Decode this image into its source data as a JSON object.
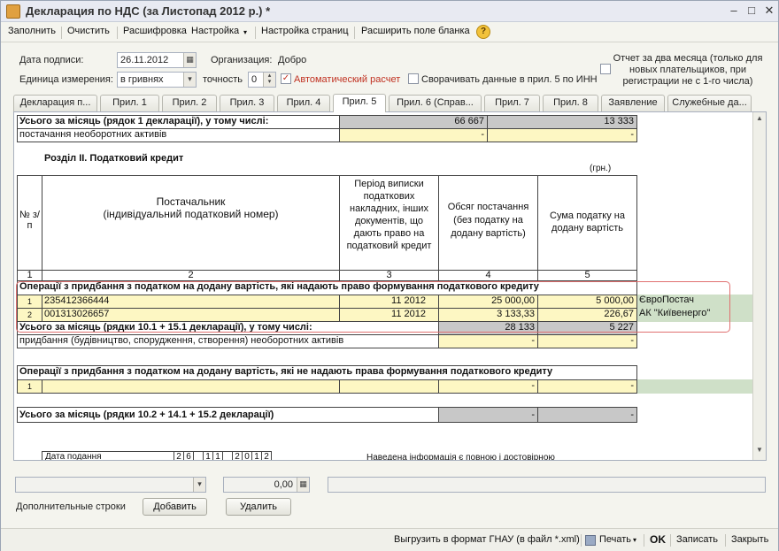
{
  "window": {
    "title": "Декларация по НДС (за Листопад 2012 р.) *",
    "minimize": "–",
    "maximize": "□",
    "close": "✕"
  },
  "toolbar": {
    "fill": "Заполнить",
    "clear": "Очистить",
    "decode": "Расшифровка",
    "settings": "Настройка",
    "settings_arrow": "▾",
    "page_settings": "Настройка страниц",
    "expand_form": "Расширить поле бланка",
    "help": "?"
  },
  "form": {
    "sign_date_label": "Дата подписи:",
    "sign_date": "26.11.2012",
    "org_label": "Организация:",
    "org_value": "Добро",
    "unit_label": "Единица измерения:",
    "unit_value": "в гривнях",
    "precision_label": "точность",
    "precision_value": "0",
    "auto_calc_label": "Автоматический расчет",
    "auto_calc_checked": "✓",
    "collapse_label": "Сворачивать данные в прил. 5 по ИНН",
    "two_month_report": "Отчет за два месяца (только для новых плательщиков, при регистрации не с 1-го числа)"
  },
  "tabs": [
    {
      "label": "Декларация п..."
    },
    {
      "label": "Прил. 1"
    },
    {
      "label": "Прил. 2"
    },
    {
      "label": "Прил. 3"
    },
    {
      "label": "Прил. 4"
    },
    {
      "label": "Прил. 5"
    },
    {
      "label": "Прил. 6 (Справ..."
    },
    {
      "label": "Прил. 7"
    },
    {
      "label": "Прил. 8"
    },
    {
      "label": "Заявление"
    },
    {
      "label": "Служебные да..."
    }
  ],
  "sheet": {
    "total1_label": "Усього за місяць (рядок 1 декларації), у тому числі:",
    "total1_v1": "66 667",
    "total1_v2": "13 333",
    "supply_noncurrent": "постачання необоротних активів",
    "dash": "-",
    "section_title": "Розділ ІІ. Податковий кредит",
    "currency_note": "(грн.)",
    "hdr_num": "№ з/п",
    "hdr_supplier": "Постачальник\n(індивідуальний податковий номер)",
    "hdr_period": "Період виписки податкових накладних, інших документів, що дають право на податковий кредит",
    "hdr_volume": "Обсяг постачання (без податку на додану вартість)",
    "hdr_tax": "Сума податку на додану вартість",
    "col_nums": [
      "1",
      "2",
      "3",
      "4",
      "5"
    ],
    "ops_with_right": "Операції з придбання з податком на додану вартість, які надають право формування податкового кредиту",
    "rows": [
      {
        "num": "1",
        "inn": "235412366444",
        "period": "11  2012",
        "volume": "25 000,00",
        "tax": "5 000,00",
        "name": "ЄвроПостач"
      },
      {
        "num": "2",
        "inn": "001313026657",
        "period": "11  2012",
        "volume": "3 133,33",
        "tax": "226,67",
        "name": "АК \"Київенерго\""
      }
    ],
    "total2_label": "Усього за місяць (рядки 10.1 + 15.1 декларації), у тому числі:",
    "total2_v1": "28 133",
    "total2_v2": "5 227",
    "purchase_noncurrent": "придбання (будівництво, спорудження, створення) необоротних активів",
    "ops_without_right": "Операції з придбання з податком на додану вартість, які не надають права формування податкового кредиту",
    "row_empty_num": "1",
    "total3_label": "Усього за місяць (рядки 10.2 + 14.1 + 15.2 декларації)",
    "partial_label": "Дата подання",
    "partial_digits": [
      "2",
      "6",
      "",
      "1",
      "1",
      "",
      "2",
      "0",
      "1",
      "2"
    ],
    "partial_info": "Наведена інформація є повною і достовірною"
  },
  "bottom": {
    "amount": "0,00",
    "extra_rows_label": "Дополнительные строки",
    "add": "Добавить",
    "delete": "Удалить"
  },
  "status": {
    "export": "Выгрузить в формат ГНАУ (в файл *.xml)",
    "print": "Печать",
    "print_arrow": "▾",
    "ok": "OK",
    "save": "Записать",
    "close": "Закрыть"
  }
}
